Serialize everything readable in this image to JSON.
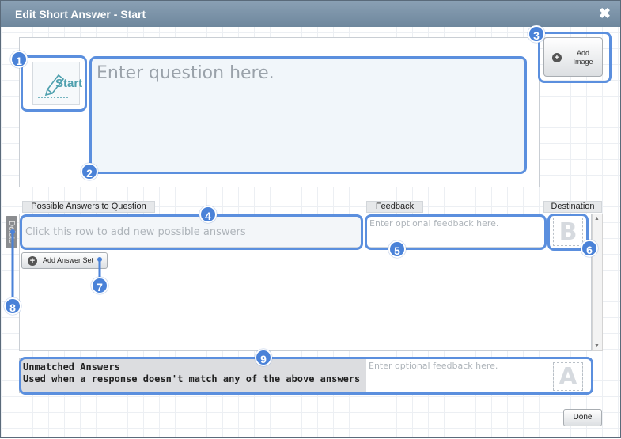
{
  "dialog": {
    "title": "Edit Short Answer - Start",
    "close_glyph": "✖"
  },
  "question": {
    "start_icon_label": "Start",
    "placeholder": "Enter question here.",
    "value": ""
  },
  "add_image": {
    "label": "Add Image",
    "icon": "plus-circle-icon"
  },
  "columns": {
    "possible_answers": "Possible Answers to Question",
    "feedback": "Feedback",
    "destination": "Destination"
  },
  "answer_row": {
    "delete_label": "Delete",
    "placeholder": "Click this row to add new possible answers",
    "feedback_placeholder": "Enter optional feedback here.",
    "destination": "B"
  },
  "add_answer_set": {
    "label": "Add Answer Set",
    "icon": "plus-circle-icon"
  },
  "unmatched": {
    "title": "Unmatched Answers",
    "subtitle": "Used when a response doesn't match any of the above answers",
    "feedback_placeholder": "Enter optional feedback here.",
    "destination": "A"
  },
  "done_label": "Done",
  "callouts": [
    "1",
    "2",
    "3",
    "4",
    "5",
    "6",
    "7",
    "8",
    "9"
  ],
  "colors": {
    "callout_blue": "#4a82d8",
    "titlebar": "#7a92a8"
  }
}
